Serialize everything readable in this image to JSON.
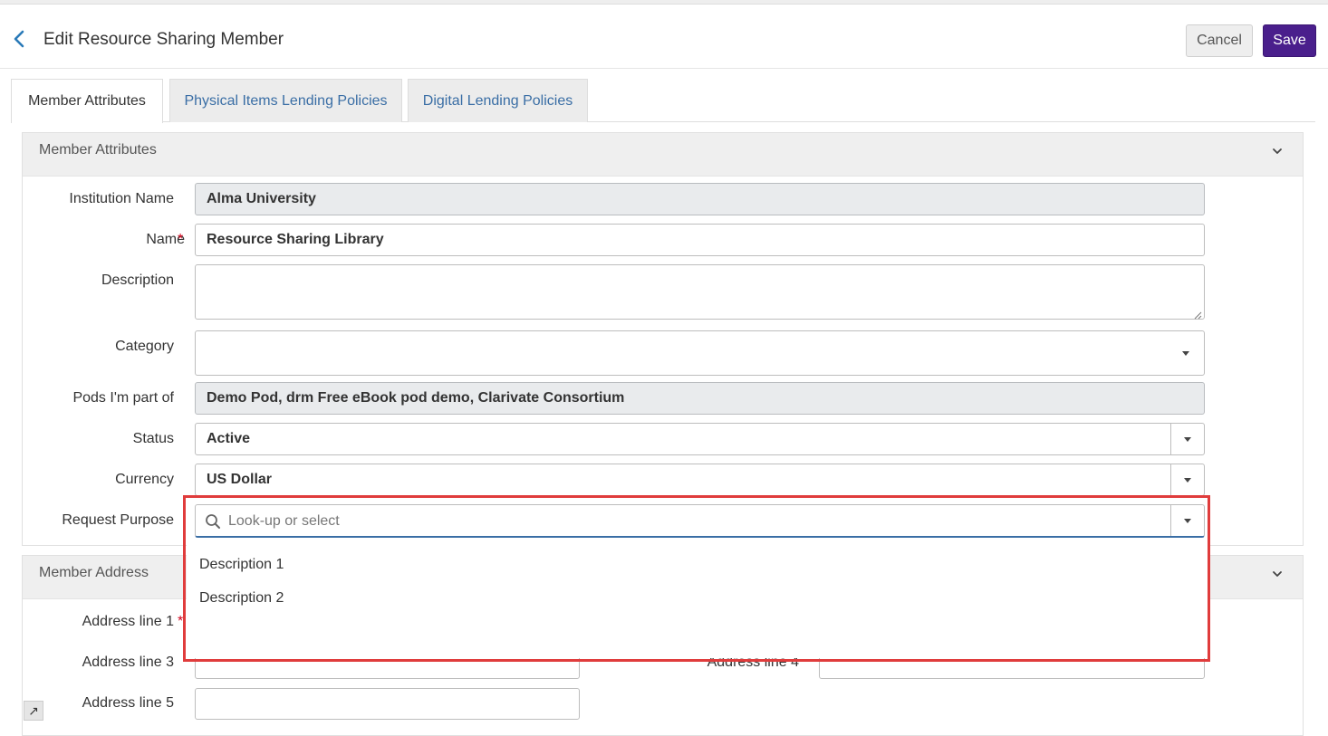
{
  "header": {
    "title": "Edit Resource Sharing Member",
    "cancel_label": "Cancel",
    "save_label": "Save"
  },
  "tabs": [
    {
      "label": "Member Attributes",
      "active": true
    },
    {
      "label": "Physical Items Lending Policies",
      "active": false
    },
    {
      "label": "Digital Lending Policies",
      "active": false
    }
  ],
  "member_attributes": {
    "section_title": "Member Attributes",
    "institution_name": {
      "label": "Institution Name",
      "value": "Alma University"
    },
    "name": {
      "label": "Name",
      "required_mark": "*",
      "value": "Resource Sharing Library"
    },
    "description": {
      "label": "Description",
      "value": ""
    },
    "category": {
      "label": "Category",
      "value": ""
    },
    "pods": {
      "label": "Pods I'm part of",
      "value": "Demo Pod, drm Free eBook pod demo, Clarivate Consortium"
    },
    "status": {
      "label": "Status",
      "value": "Active"
    },
    "currency": {
      "label": "Currency",
      "value": "US Dollar"
    },
    "request_purpose": {
      "label": "Request Purpose",
      "placeholder": "Look-up or select",
      "options": [
        "Description 1",
        "Description 2"
      ]
    }
  },
  "member_address": {
    "section_title": "Member Address",
    "address_line_1": {
      "label": "Address line 1",
      "required_mark": "*"
    },
    "address_line_3": {
      "label": "Address line 3"
    },
    "address_line_4": {
      "label": "Address line 4"
    },
    "address_line_5": {
      "label": "Address line 5"
    }
  },
  "expand_glyph": "↗",
  "colors": {
    "accent": "#4a1f8c",
    "link": "#3a6ea5",
    "required": "#d0021b",
    "highlight": "#e03c3c"
  }
}
